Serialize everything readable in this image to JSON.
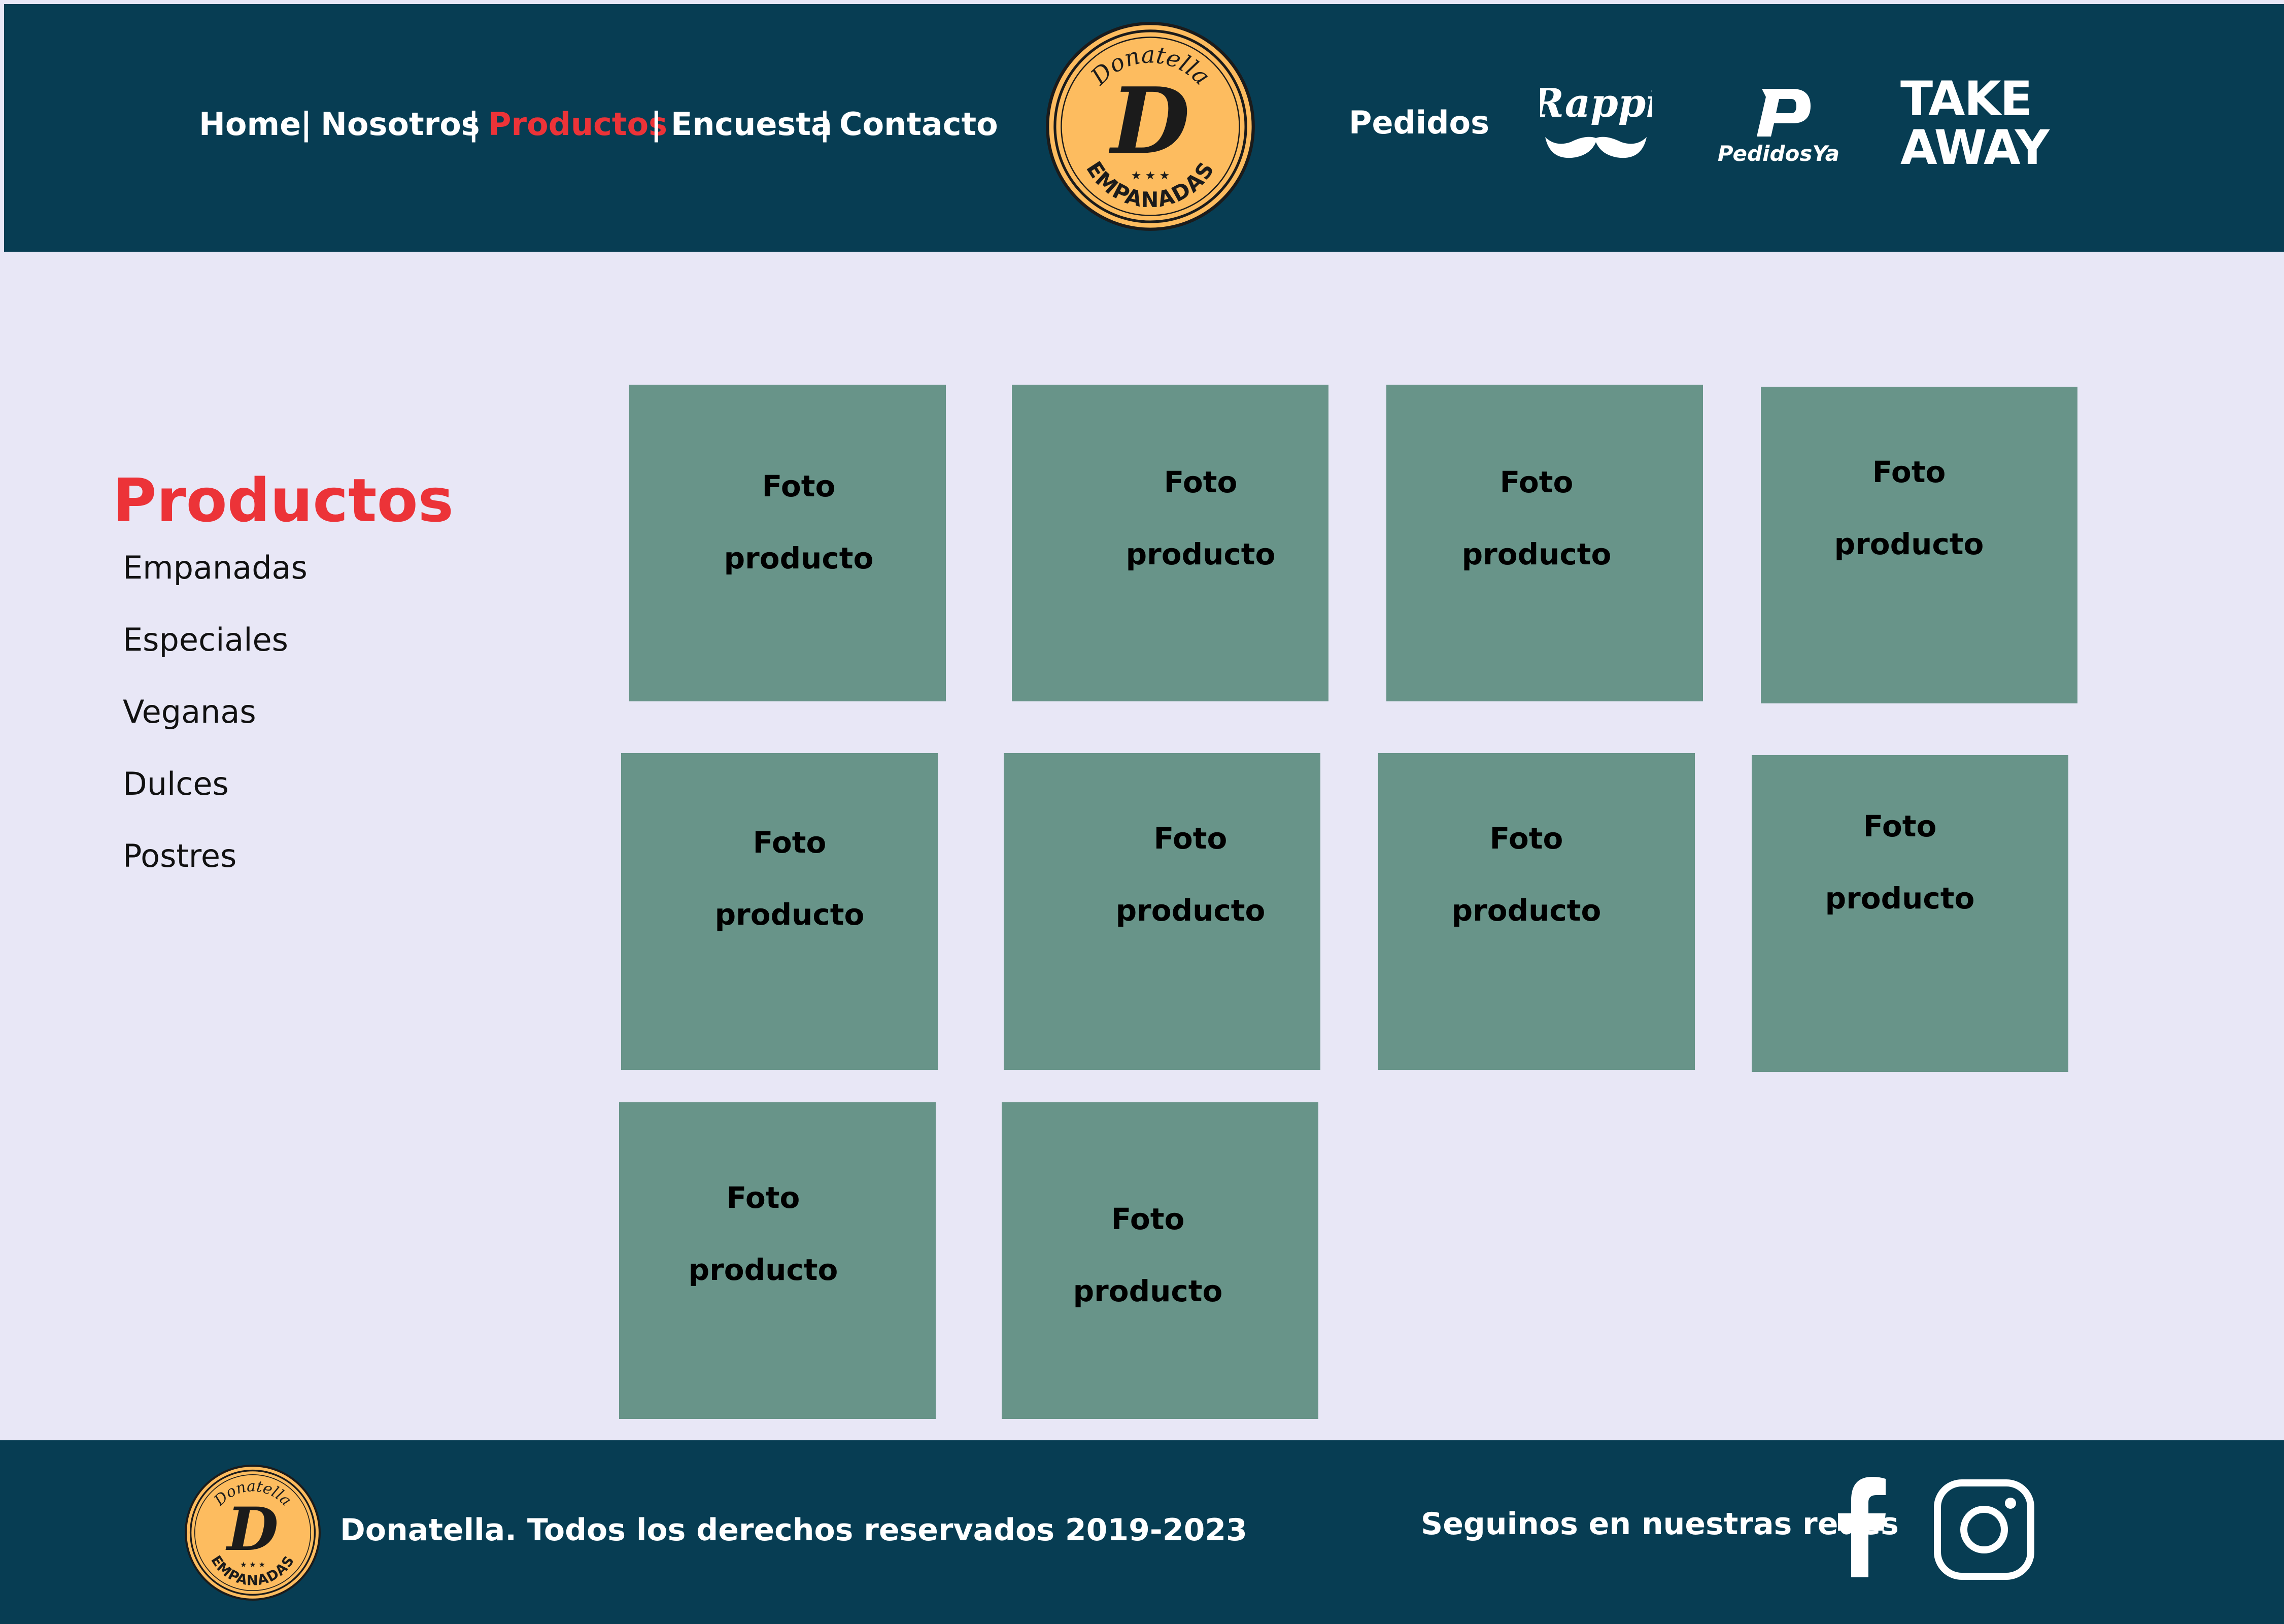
{
  "header": {
    "nav": [
      {
        "label": "Home"
      },
      {
        "label": "Nosotros"
      },
      {
        "label": "Productos",
        "active": true
      },
      {
        "label": "Encuesta"
      },
      {
        "label": "Contacto"
      }
    ],
    "separator": "|",
    "logo": {
      "top_text": "Donatella",
      "letter": "D",
      "bottom_text": "EMPANADAS",
      "stars": "★ ★ ★"
    },
    "pedidos_label": "Pedidos",
    "delivery": [
      {
        "name": "Rappi",
        "icon": "rappi-mustache-icon"
      },
      {
        "name": "PedidosYa",
        "icon": "pedidosya-p-icon"
      },
      {
        "name": "TAKE AWAY",
        "line1": "TAKE",
        "line2": "AWAY"
      }
    ]
  },
  "sidebar": {
    "title": "Productos",
    "categories": [
      "Empanadas",
      "Especiales",
      "Veganas",
      "Dulces",
      "Postres"
    ]
  },
  "products": {
    "line1": "Foto",
    "line2": "producto",
    "count": 10
  },
  "footer": {
    "copyright": "Donatella. Todos los derechos reservados 2019-2023",
    "social_label": "Seguinos en nuestras redes",
    "social": [
      {
        "name": "facebook",
        "icon": "facebook-icon"
      },
      {
        "name": "instagram",
        "icon": "instagram-icon"
      }
    ]
  },
  "colors": {
    "header_bg": "#073d53",
    "page_bg": "#e8e7f6",
    "accent_red": "#ec3338",
    "tile": "#689489",
    "logo_fill": "#fdbc5f"
  }
}
